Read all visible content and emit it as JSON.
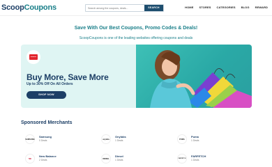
{
  "header": {
    "logo_part1": "Scoop",
    "logo_part2": "Coupons",
    "search_placeholder": "Search among the coupons, deals...",
    "search_button": "SEARCH",
    "nav": [
      "HOME",
      "STORES",
      "CATEGORIES",
      "BLOG",
      "REWARD"
    ]
  },
  "hero": {
    "tagline": "Save With Our Best Coupons, Promo Codes & Deals!",
    "subtag": "ScoopCoupons is one of the leading websites offering coupons and deals"
  },
  "banner": {
    "brand": "amazon",
    "headline": "Buy More, Save More",
    "offer": "Up to 30% Off On All Orders",
    "button": "SHOP NOW"
  },
  "merchants": {
    "title": "Sponsored Merchants",
    "items": [
      {
        "name": "Samsung",
        "deals": "0 Deals",
        "logo": "SAMSUNG"
      },
      {
        "name": "Onylabs",
        "deals": "1 Deals",
        "logo": "onylabs"
      },
      {
        "name": "Puma",
        "deals": "1 Deals",
        "logo": "PUMA"
      },
      {
        "name": "New Balance",
        "deals": "2 Deals",
        "logo": "NB"
      },
      {
        "name": "Diesel",
        "deals": "1 Deals",
        "logo": "DIESEL"
      },
      {
        "name": "FARFETCH",
        "deals": "1 Deals",
        "logo": "FARFETCH"
      }
    ]
  },
  "colors": {
    "brand_navy": "#1d3f66",
    "brand_teal": "#1a7f89",
    "banner_bg": "#dff5f3",
    "banner_image": "#3ec0b6",
    "amazon_red": "#e3262e"
  }
}
